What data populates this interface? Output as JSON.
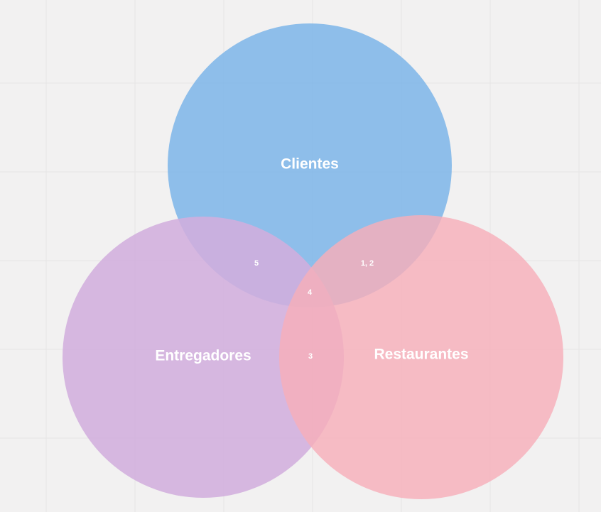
{
  "venn": {
    "sets": [
      {
        "id": "clientes",
        "label": "Clientes",
        "color": "#7fb6e8"
      },
      {
        "id": "entregadores",
        "label": "Entregadores",
        "color": "#d2aedd"
      },
      {
        "id": "restaurantes",
        "label": "Restaurantes",
        "color": "#f6aeb9"
      }
    ],
    "regions": {
      "clientes_entregadores": "5",
      "clientes_restaurantes": "1, 2",
      "all_three": "4",
      "entregadores_restaurantes": "3"
    }
  }
}
